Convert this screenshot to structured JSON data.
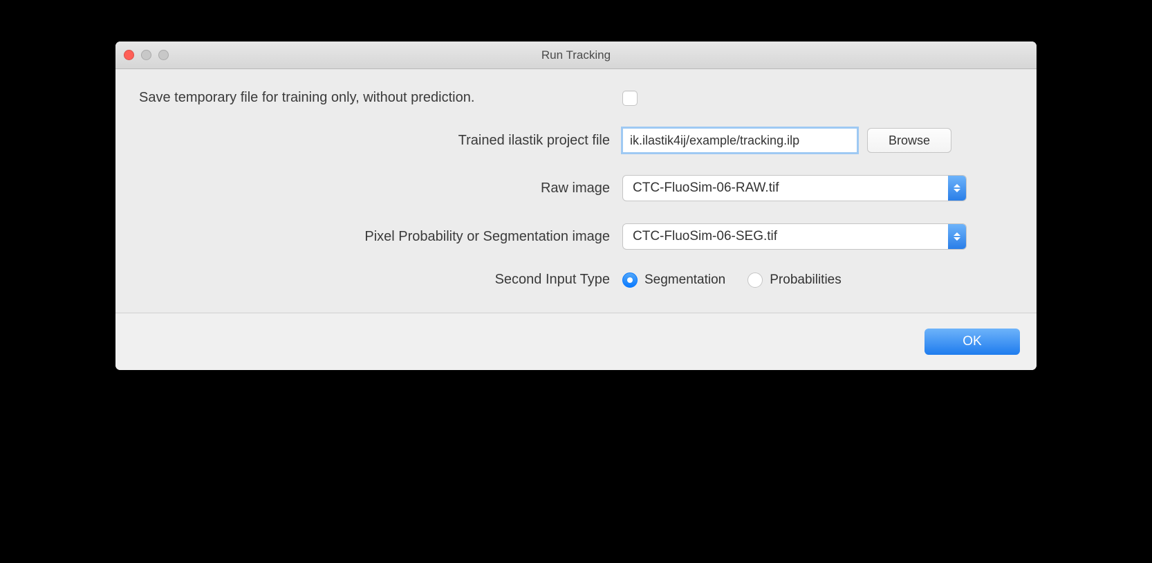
{
  "window": {
    "title": "Run Tracking"
  },
  "form": {
    "save_temp": {
      "label": "Save temporary file for training only, without prediction.",
      "checked": false
    },
    "project_file": {
      "label": "Trained ilastik project file",
      "value": "ik.ilastik4ij/example/tracking.ilp",
      "browse_label": "Browse"
    },
    "raw_image": {
      "label": "Raw image",
      "value": "CTC-FluoSim-06-RAW.tif"
    },
    "seg_image": {
      "label": "Pixel Probability or Segmentation image",
      "value": "CTC-FluoSim-06-SEG.tif"
    },
    "input_type": {
      "label": "Second Input Type",
      "options": {
        "segmentation": "Segmentation",
        "probabilities": "Probabilities"
      },
      "selected": "segmentation"
    }
  },
  "footer": {
    "ok_label": "OK"
  }
}
